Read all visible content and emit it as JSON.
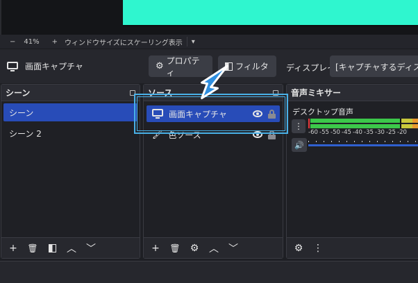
{
  "scalebar": {
    "zoom": "41%",
    "minus": "−",
    "plus": "+",
    "label": "ウィンドウサイズにスケーリング表示",
    "dropdown": "▾"
  },
  "toolbar": {
    "source_name": "画面キャプチャ",
    "properties": "プロパティ",
    "filters": "フィルタ",
    "display_label": "ディスプレイ",
    "display_value": "[キャプチャするディスプレ"
  },
  "scenes": {
    "title": "シーン",
    "items": [
      "シーン",
      "シーン 2"
    ]
  },
  "sources": {
    "title": "ソース",
    "items": [
      "画面キャプチャ",
      "色ソース"
    ]
  },
  "mixer": {
    "title": "音声ミキサー",
    "channel": "デスクトップ音声",
    "ticks": [
      "-60",
      "-55",
      "-50",
      "-45",
      "-40",
      "-35",
      "-30",
      "-25",
      "-20"
    ]
  },
  "colors": {
    "accent": "#284cb8",
    "highlight": "#49b1e8",
    "preview": "#2ff6cf"
  }
}
